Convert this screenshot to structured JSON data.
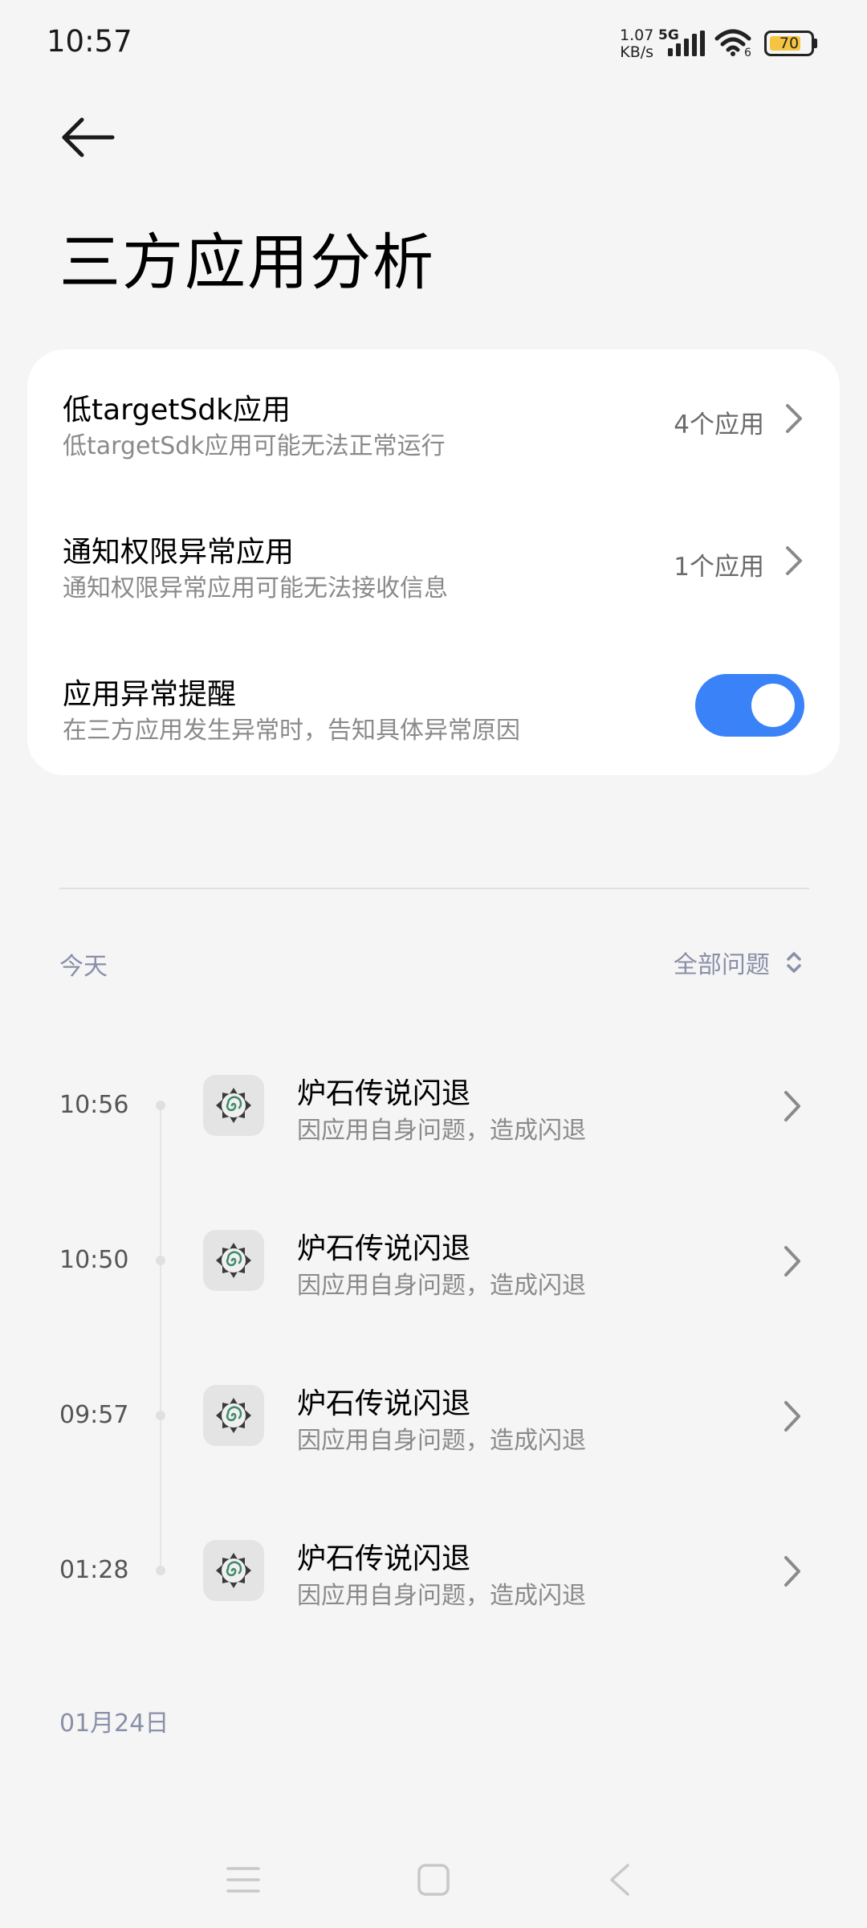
{
  "status_bar": {
    "time": "10:57",
    "net_speed_value": "1.07",
    "net_speed_unit": "KB/s",
    "network_type": "5G",
    "wifi_sub": "6",
    "battery_level": "70"
  },
  "header": {
    "title": "三方应用分析"
  },
  "card": {
    "rows": [
      {
        "title": "低targetSdk应用",
        "subtitle": "低targetSdk应用可能无法正常运行",
        "value": "4个应用"
      },
      {
        "title": "通知权限异常应用",
        "subtitle": "通知权限异常应用可能无法接收信息",
        "value": "1个应用"
      },
      {
        "title": "应用异常提醒",
        "subtitle": "在三方应用发生异常时，告知具体异常原因",
        "toggle_on": true
      }
    ]
  },
  "section": {
    "label": "今天",
    "filter_label": "全部问题"
  },
  "entries": [
    {
      "time": "10:56",
      "title": "炉石传说闪退",
      "subtitle": "因应用自身问题，造成闪退"
    },
    {
      "time": "10:50",
      "title": "炉石传说闪退",
      "subtitle": "因应用自身问题，造成闪退"
    },
    {
      "time": "09:57",
      "title": "炉石传说闪退",
      "subtitle": "因应用自身问题，造成闪退"
    },
    {
      "time": "01:28",
      "title": "炉石传说闪退",
      "subtitle": "因应用自身问题，造成闪退"
    }
  ],
  "date_label": "01月24日",
  "colors": {
    "accent": "#3a82f7",
    "background": "#f5f5f5",
    "card": "#ffffff",
    "secondary_text": "#8a8a8a",
    "section_text": "#8a8fa8"
  },
  "icons": {
    "back": "arrow-left-icon",
    "chevron": "chevron-right-icon",
    "filter": "sort-updown-icon",
    "app": "hearthstone-app-icon"
  }
}
